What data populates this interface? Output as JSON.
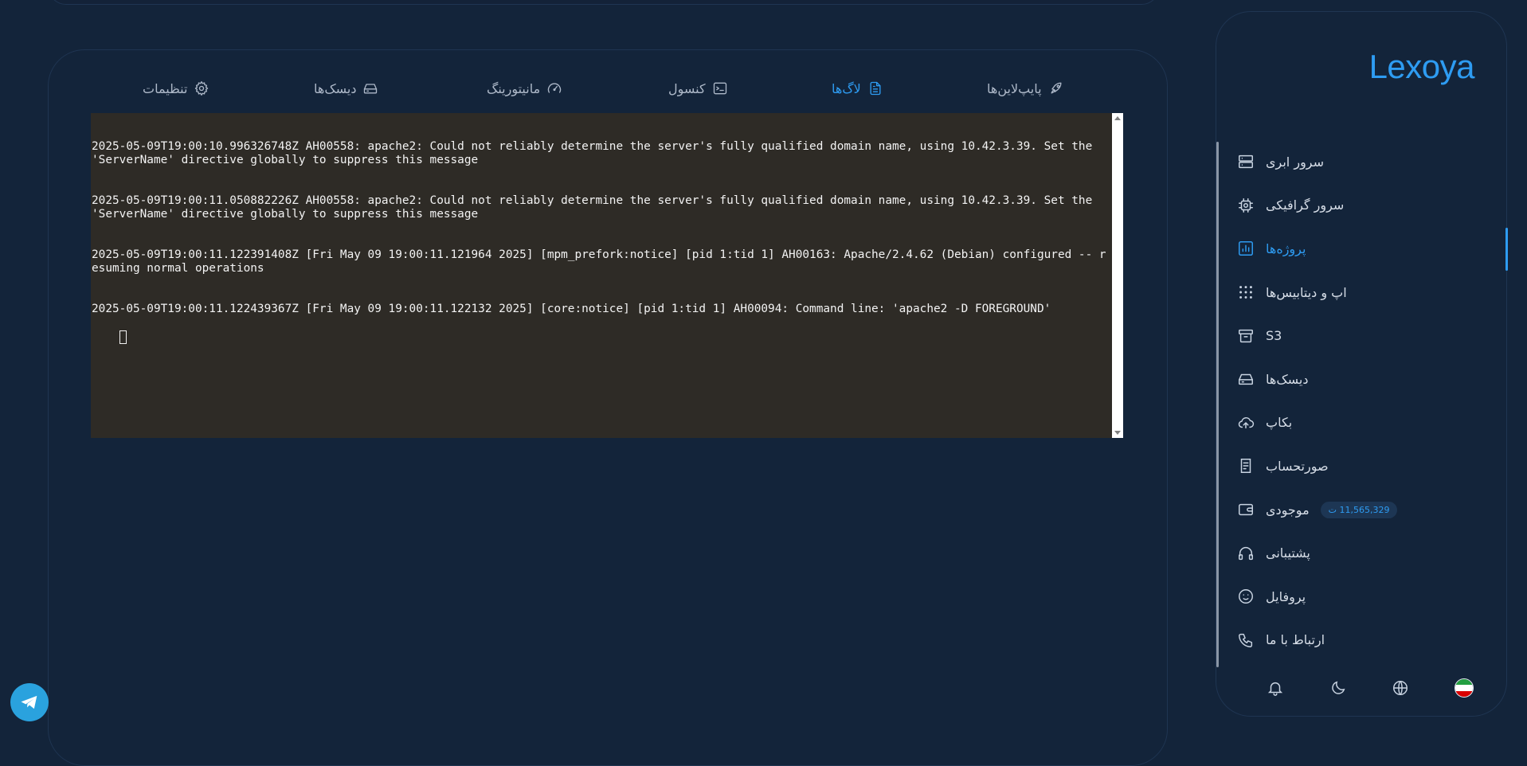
{
  "brand": "Lexoya",
  "tabs": [
    {
      "label": "پایپ‌لاین‌ها",
      "icon": "rocket-icon"
    },
    {
      "label": "لاگ‌ها",
      "icon": "file-text-icon",
      "active": true
    },
    {
      "label": "کنسول",
      "icon": "terminal-icon"
    },
    {
      "label": "مانیتورینگ",
      "icon": "gauge-icon"
    },
    {
      "label": "دیسک‌ها",
      "icon": "disk-icon"
    },
    {
      "label": "تنظیمات",
      "icon": "gear-icon"
    }
  ],
  "terminal": {
    "lines": [
      "2025-05-09T19:00:10.996326748Z AH00558: apache2: Could not reliably determine the server's fully qualified domain name, using 10.42.3.39. Set the 'ServerName' directive globally to suppress this message",
      "2025-05-09T19:00:11.050882226Z AH00558: apache2: Could not reliably determine the server's fully qualified domain name, using 10.42.3.39. Set the 'ServerName' directive globally to suppress this message",
      "2025-05-09T19:00:11.122391408Z [Fri May 09 19:00:11.121964 2025] [mpm_prefork:notice] [pid 1:tid 1] AH00163: Apache/2.4.62 (Debian) configured -- resuming normal operations",
      "2025-05-09T19:00:11.122439367Z [Fri May 09 19:00:11.122132 2025] [core:notice] [pid 1:tid 1] AH00094: Command line: 'apache2 -D FOREGROUND'"
    ]
  },
  "sidebar": {
    "items": [
      {
        "label": "سرور ابری",
        "icon": "server-icon"
      },
      {
        "label": "سرور گرافیکی",
        "icon": "chip-icon"
      },
      {
        "label": "پروژه‌ها",
        "icon": "chart-icon",
        "active": true
      },
      {
        "label": "اپ و دیتابیس‌ها",
        "icon": "grid-icon"
      },
      {
        "label": "S3",
        "icon": "archive-icon"
      },
      {
        "label": "دیسک‌ها",
        "icon": "disk-icon"
      },
      {
        "label": "بکاپ",
        "icon": "cloud-upload-icon"
      },
      {
        "label": "صورتحساب",
        "icon": "receipt-icon"
      },
      {
        "label": "موجودی",
        "icon": "wallet-icon",
        "badge": "11,565,329 ت"
      },
      {
        "label": "پشتیبانی",
        "icon": "headset-icon"
      },
      {
        "label": "پروفایل",
        "icon": "face-icon"
      },
      {
        "label": "ارتباط با ما",
        "icon": "phone-icon"
      }
    ]
  },
  "footer_icons": [
    "flag-icon",
    "globe-icon",
    "moon-icon",
    "bell-icon"
  ],
  "colors": {
    "accent": "#2e9cf2",
    "background": "#13243a",
    "terminal_bg": "#2e2b26"
  }
}
